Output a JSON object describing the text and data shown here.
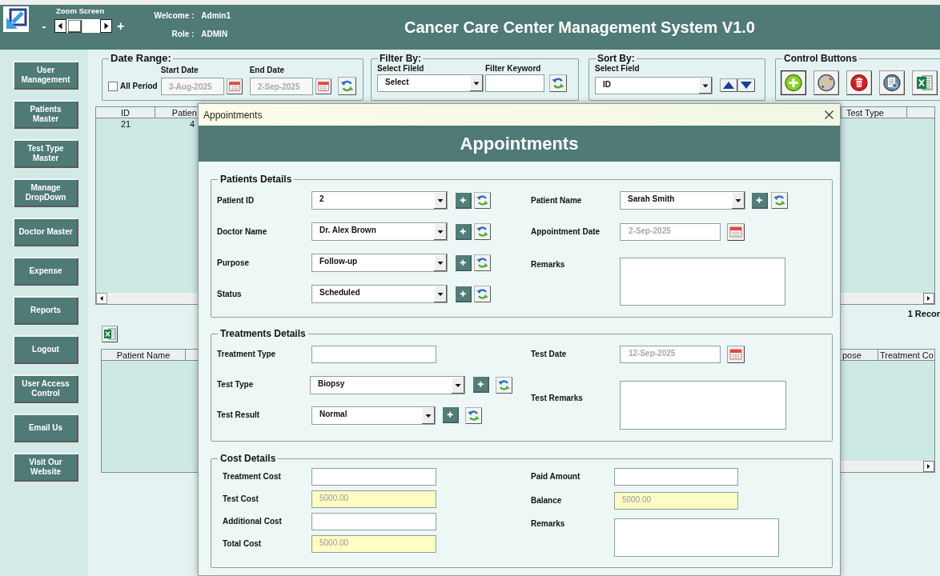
{
  "header": {
    "zoom": {
      "label": "Zoom Screen",
      "minus": "-",
      "plus": "+"
    },
    "user": [
      {
        "label": "Welcome :",
        "value": "Admin1"
      },
      {
        "label": "Role :",
        "value": "ADMIN"
      }
    ],
    "title": "Cancer Care Center Management System V1.0"
  },
  "sidebar": {
    "items": [
      "User Management",
      "Patients Master",
      "Test Type Master",
      "Manage DropDown",
      "Doctor Master",
      "Expense",
      "Reports",
      "Logout",
      "User Access Control",
      "Email Us",
      "Visit Our Website"
    ]
  },
  "date_range": {
    "title": "Date Range:",
    "all_period": {
      "label": "All Period",
      "checked": false
    },
    "fields": [
      {
        "label": "Start Date",
        "value": "3-Aug-2025",
        "disabled": true
      },
      {
        "label": "End Date",
        "value": "2-Sep-2025",
        "disabled": true
      }
    ]
  },
  "filter_by": {
    "title": "Filter By:",
    "field": {
      "label": "Select Fileld",
      "value": "Select"
    },
    "keyword": {
      "label": "Filter Keyword"
    }
  },
  "sort_by": {
    "title": "Sort By:",
    "field": {
      "label": "Select Field",
      "value": "ID"
    }
  },
  "control_buttons": {
    "title": "Control Buttons"
  },
  "records_table": {
    "columns": [
      "ID",
      "Patien",
      "Test Type"
    ],
    "rows": [
      [
        "21",
        "4"
      ]
    ],
    "count": "1 Recor"
  },
  "appointments_table": {
    "columns": [
      "Patient Name",
      "pose",
      "Treatment Co"
    ]
  },
  "dialog": {
    "window_title": "Appointments",
    "heading": "Appointments",
    "sections": [
      {
        "title": "Patients Details",
        "left": [
          {
            "kind": "combo",
            "label": "Patient ID",
            "value": "2"
          },
          {
            "kind": "combo",
            "label": "Doctor Name",
            "value": "Dr. Alex Brown"
          },
          {
            "kind": "combo",
            "label": "Purpose",
            "value": "Follow-up"
          },
          {
            "kind": "combo",
            "label": "Status",
            "value": "Scheduled"
          }
        ],
        "right": [
          {
            "kind": "combo",
            "label": "Patient Name",
            "value": "Sarah Smith"
          },
          {
            "kind": "date",
            "label": "Appointment Date",
            "value": "2-Sep-2025",
            "disabled": true
          },
          {
            "kind": "textarea",
            "label": "Remarks"
          }
        ]
      },
      {
        "title": "Treatments Details",
        "left": [
          {
            "kind": "text",
            "label": "Treatment Type",
            "readonly": false
          },
          {
            "kind": "combo",
            "label": "Test Type",
            "value": "Biopsy"
          },
          {
            "kind": "combo",
            "label": "Test Result",
            "value": "Normal"
          }
        ],
        "right": [
          {
            "kind": "date",
            "label": "Test Date",
            "value": "12-Sep-2025",
            "disabled": true
          },
          {
            "kind": "textarea",
            "label": "Test Remarks"
          }
        ]
      },
      {
        "title": "Cost Details",
        "left": [
          {
            "kind": "text",
            "label": "Treatment Cost",
            "readonly": false
          },
          {
            "kind": "text",
            "label": "Test Cost",
            "value": "5000.00",
            "readonly": true
          },
          {
            "kind": "text",
            "label": "Additional Cost",
            "readonly": false
          },
          {
            "kind": "text",
            "label": "Total Cost",
            "value": "5000.00",
            "readonly": true
          }
        ],
        "right": [
          {
            "kind": "text",
            "label": "Paid Amount",
            "readonly": false
          },
          {
            "kind": "text",
            "label": "Balance",
            "value": "5000.00",
            "readonly": true
          },
          {
            "kind": "textarea",
            "label": "Remarks"
          }
        ]
      }
    ]
  }
}
